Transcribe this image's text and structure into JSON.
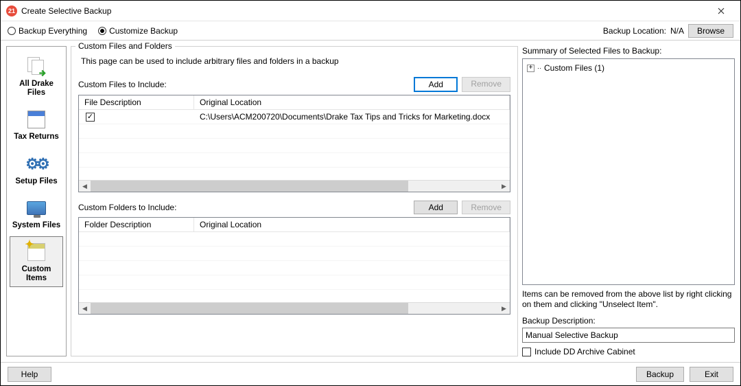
{
  "window": {
    "title": "Create Selective Backup",
    "icon_text": "21"
  },
  "options": {
    "backup_everything": "Backup Everything",
    "customize_backup": "Customize Backup",
    "selected": "customize",
    "backup_location_label": "Backup Location:",
    "backup_location_value": "N/A",
    "browse": "Browse"
  },
  "sidebar": {
    "items": [
      {
        "label": "All Drake Files"
      },
      {
        "label": "Tax Returns"
      },
      {
        "label": "Setup Files"
      },
      {
        "label": "System Files"
      },
      {
        "label": "Custom Items"
      }
    ],
    "selected_index": 4
  },
  "center": {
    "legend": "Custom Files and Folders",
    "intro": "This page can be used to include arbitrary files and folders in a  backup",
    "files_label": "Custom Files to Include:",
    "folders_label": "Custom Folders to Include:",
    "add": "Add",
    "remove": "Remove",
    "col_file_desc": "File Description",
    "col_folder_desc": "Folder Description",
    "col_location": "Original Location",
    "files": [
      {
        "checked": true,
        "desc": "",
        "location": "C:\\Users\\ACM200720\\Documents\\Drake Tax Tips and Tricks for Marketing.docx"
      }
    ],
    "folders": []
  },
  "right": {
    "summary_label": "Summary of Selected Files to Backup:",
    "tree_root": "Custom Files (1)",
    "hint": "Items can be removed from the above list by right clicking on them and clicking \"Unselect Item\".",
    "desc_label": "Backup Description:",
    "desc_value": "Manual Selective Backup",
    "include_dd": "Include DD Archive Cabinet"
  },
  "footer": {
    "help": "Help",
    "backup": "Backup",
    "exit": "Exit"
  }
}
